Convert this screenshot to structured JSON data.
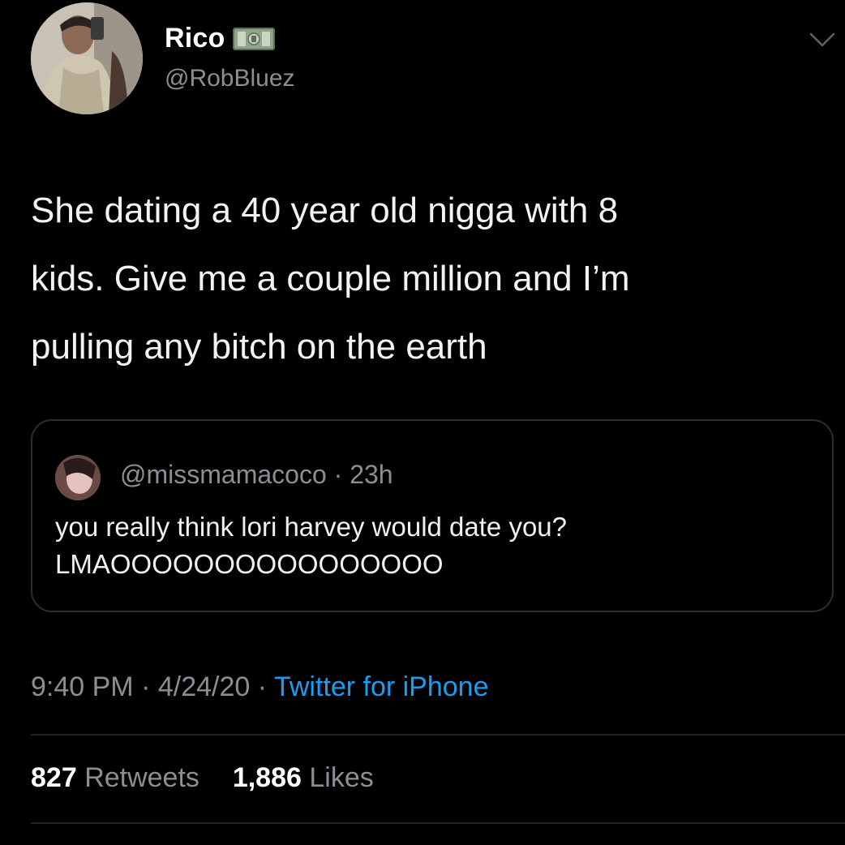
{
  "author": {
    "display_name": "Rico",
    "handle": "@RobBluez",
    "name_emoji": "money-bill-emoji"
  },
  "tweet": {
    "text": "She dating a 40 year old nigga with 8\nkids. Give me a couple million and I’m\npulling any bitch on the earth"
  },
  "quoted_tweet": {
    "handle": "@missmamacoco",
    "separator": "·",
    "time": "23h",
    "text": "you really think lori harvey would date you?\nLMAOOOOOOOOOOOOOOOO"
  },
  "meta": {
    "time": "9:40 PM",
    "sep1": "·",
    "date": "4/24/20",
    "sep2": "·",
    "source": "Twitter for iPhone"
  },
  "stats": {
    "retweets_count": "827",
    "retweets_label": "Retweets",
    "likes_count": "1,886",
    "likes_label": "Likes"
  },
  "colors": {
    "background": "#000000",
    "text": "#f2f2f2",
    "muted": "#8b8f94",
    "link": "#1d9bf0",
    "border": "#2b2f33"
  },
  "icons": {
    "menu": "chevron-down-icon"
  }
}
